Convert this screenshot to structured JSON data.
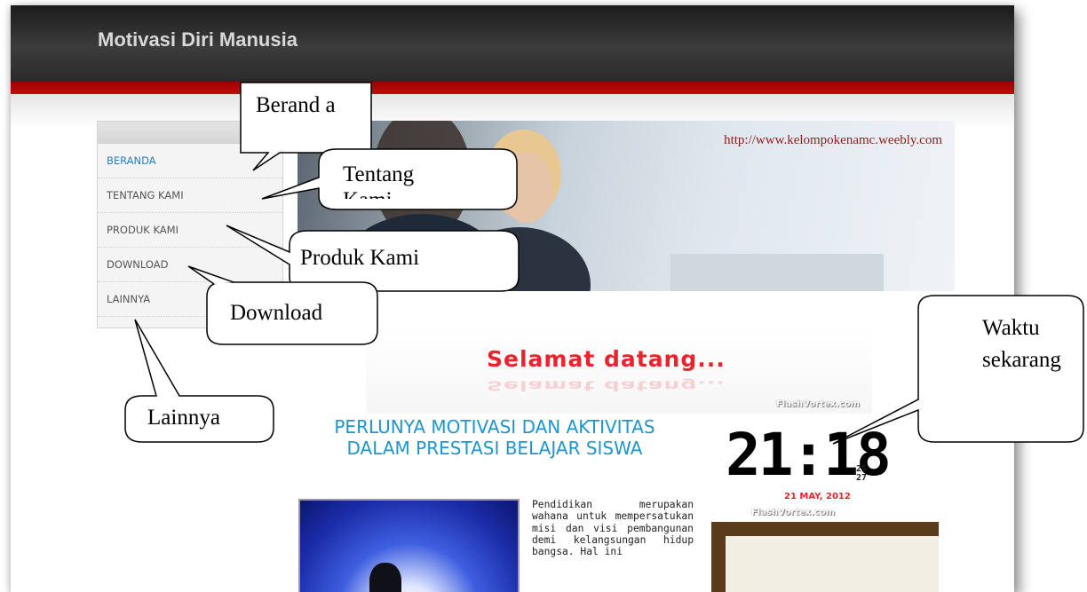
{
  "header": {
    "site_title": "Motivasi Diri Manusia"
  },
  "nav": {
    "items": [
      {
        "label": "BERANDA",
        "active": true
      },
      {
        "label": "TENTANG KAMI",
        "active": false
      },
      {
        "label": "PRODUK KAMI",
        "active": false
      },
      {
        "label": "DOWNLOAD",
        "active": false
      },
      {
        "label": "LAINNYA",
        "active": false
      }
    ]
  },
  "banner": {
    "url_text": "http://www.kelompokenamc.weebly.com"
  },
  "welcome": {
    "text": "Selamat datang...",
    "reflection": "Selamat datang..."
  },
  "flashvortex": {
    "credit_top": "FlashVortex.com",
    "credit_bottom": "FlashVortex.com"
  },
  "clock": {
    "time": "21:18",
    "seconds": "2527",
    "date": "21 MAY, 2012"
  },
  "article": {
    "title": "PERLUNYA MOTIVASI DAN AKTIVITAS DALAM PRESTASI BELAJAR SISWA",
    "body": "Pendidikan merupakan wahana untuk mempersatukan misi dan visi pembangunan demi kelangsungan hidup bangsa. Hal ini"
  },
  "callouts": {
    "beranda": "Berand a",
    "tentang": "Tentang Kami",
    "produk": "Produk Kami",
    "download": "Download",
    "lainnya": "Lainnya",
    "waktu": "Waktu sekarang"
  },
  "colors": {
    "header": "#2e2e2e",
    "accent_red": "#b30a0a",
    "nav_active": "#2e7fbf",
    "article_title": "#1e95cf",
    "welcome": "#e8242e"
  }
}
